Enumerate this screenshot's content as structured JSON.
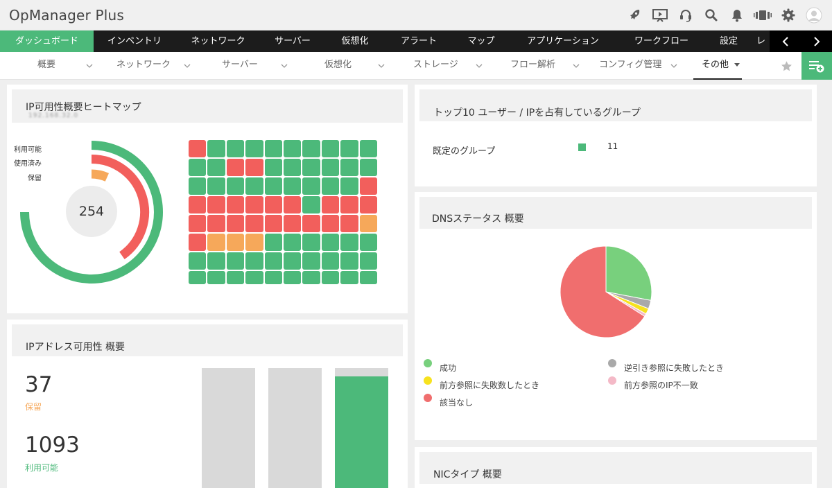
{
  "app": {
    "title": "OpManager Plus"
  },
  "top_icons": [
    "rocket-icon",
    "presentation-icon",
    "headset-icon",
    "search-icon",
    "bell-icon",
    "integration-icon",
    "gear-icon",
    "user-avatar-icon"
  ],
  "main_nav": {
    "items": [
      {
        "label": "ダッシュボード",
        "active": true
      },
      {
        "label": "インベントリ",
        "active": false
      },
      {
        "label": "ネットワーク",
        "active": false
      },
      {
        "label": "サーバー",
        "active": false
      },
      {
        "label": "仮想化",
        "active": false
      },
      {
        "label": "アラート",
        "active": false
      },
      {
        "label": "マップ",
        "active": false
      },
      {
        "label": "アプリケーション",
        "active": false
      },
      {
        "label": "ワークフロー",
        "active": false
      },
      {
        "label": "設定",
        "active": false
      },
      {
        "label": "レ",
        "active": false
      }
    ]
  },
  "sub_nav": {
    "items": [
      {
        "label": "概要"
      },
      {
        "label": "ネットワーク"
      },
      {
        "label": "サーバー"
      },
      {
        "label": "仮想化"
      },
      {
        "label": "ストレージ"
      },
      {
        "label": "フロー解析"
      },
      {
        "label": "コンフィグ管理"
      },
      {
        "label": "その他"
      }
    ]
  },
  "colors": {
    "green": "#4cb97a",
    "red": "#f25f5c",
    "orange": "#f6a85a",
    "pie_green": "#78d07d",
    "pie_red": "#f06e6e",
    "pie_gray": "#a9a9a9",
    "pie_yellow": "#f7e21e",
    "pie_pink": "#f4b9c7"
  },
  "heatmap_panel": {
    "title": "IP可用性概要ヒートマップ",
    "subtitle": "192.168.32.0",
    "legend": [
      "利用可能",
      "使用済み",
      "保留"
    ],
    "center_value": "254",
    "grid": [
      "RGGGGGGGGG",
      "GGRRGGGGGG",
      "GGGGGGGGGR",
      "RRRRRRGRRR",
      "RRRRRRRRRO",
      "ROOOGGGGGG",
      "GGGGGGGGGG",
      "GGGGGGGGGG"
    ]
  },
  "ip_address_panel": {
    "title": "IPアドレス可用性 概要",
    "stats": [
      {
        "value": "37",
        "label": "保留",
        "color": "#f6a85a"
      },
      {
        "value": "1093",
        "label": "利用可能",
        "color": "#4cb97a"
      }
    ],
    "bar_fill_fractions": [
      0,
      0,
      0.93
    ]
  },
  "top10_panel": {
    "title": "トップ10 ユーザー / IPを占有しているグループ",
    "group_label": "既定のグループ",
    "group_count": "11"
  },
  "dns_panel": {
    "title": "DNSステータス 概要",
    "legend": [
      {
        "label": "成功",
        "color": "#78d07d"
      },
      {
        "label": "逆引き参照に失敗したとき",
        "color": "#a9a9a9"
      },
      {
        "label": "前方参照に失敗数したとき",
        "color": "#f7e21e"
      },
      {
        "label": "前方参照のIP不一致",
        "color": "#f4b9c7"
      },
      {
        "label": "該当なし",
        "color": "#f06e6e"
      }
    ],
    "chart_data": {
      "type": "pie",
      "categories": [
        "成功",
        "逆引き参照に失敗したとき",
        "前方参照に失敗数したとき",
        "前方参照のIP不一致",
        "該当なし"
      ],
      "values": [
        28,
        3,
        2,
        1,
        66
      ]
    }
  },
  "nic_panel": {
    "title": "NICタイプ 概要"
  }
}
